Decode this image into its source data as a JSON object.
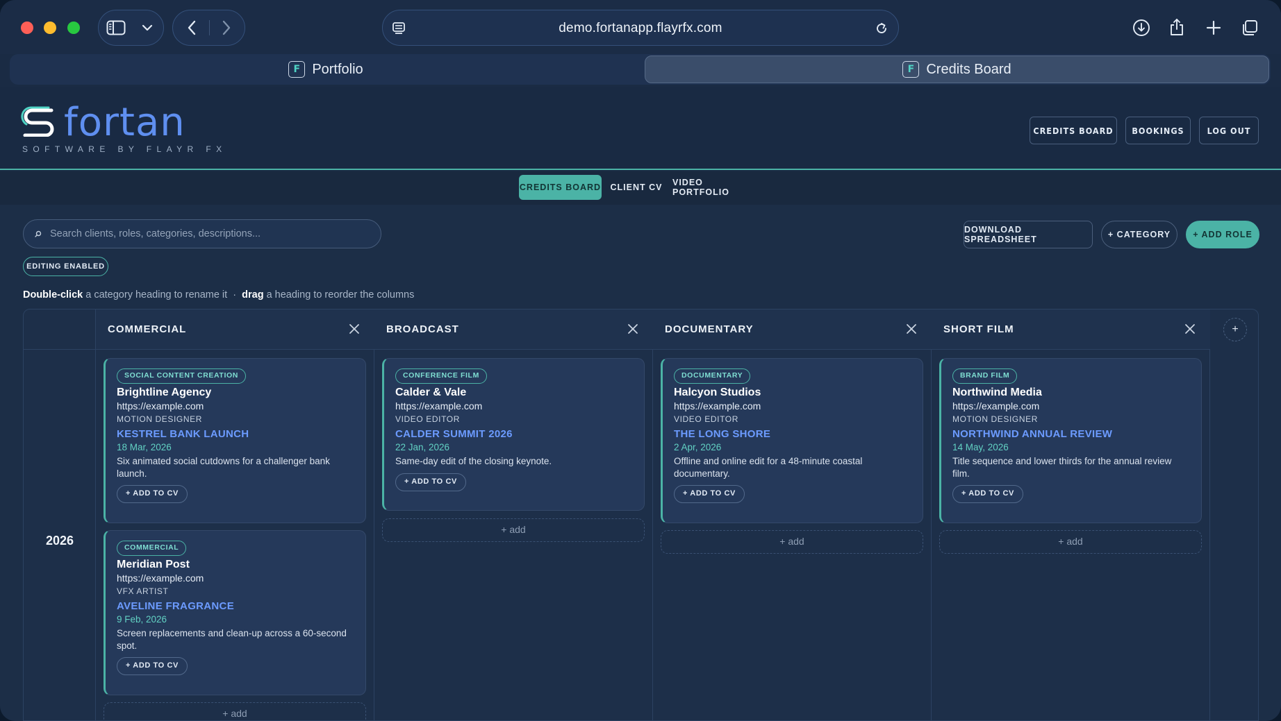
{
  "browser": {
    "url": "demo.fortanapp.flayrfx.com",
    "tabs": [
      {
        "label": "Portfolio",
        "favicon": "F"
      },
      {
        "label": "Credits Board",
        "favicon": "F"
      }
    ]
  },
  "header": {
    "logo_word": "fortan",
    "logo_tagline": "SOFTWARE BY FLAYR FX",
    "nav": [
      "CREDITS BOARD",
      "BOOKINGS",
      "LOG OUT"
    ]
  },
  "subnav": [
    "CREDITS BOARD",
    "CLIENT CV",
    "VIDEO PORTFOLIO"
  ],
  "toolbar": {
    "search_placeholder": "Search clients, roles, categories, descriptions...",
    "download_label": "DOWNLOAD SPREADSHEET",
    "category_label": "+ CATEGORY",
    "add_role_label": "+ ADD ROLE",
    "editing_badge": "EDITING ENABLED"
  },
  "hint": {
    "part1_bold": "Double-click",
    "part2": " a category heading to rename it  ·  ",
    "part3_bold": "drag",
    "part4": " a heading to reorder the columns"
  },
  "board": {
    "year": "2026",
    "add_column_label": "+",
    "add_slot_label": "+ add",
    "columns": [
      {
        "title": "COMMERCIAL",
        "cards": [
          {
            "tag": "SOCIAL CONTENT CREATION",
            "client": "Brightline Agency",
            "url": "https://example.com",
            "role": "MOTION DESIGNER",
            "project": "KESTREL BANK LAUNCH",
            "date": "18 Mar, 2026",
            "desc": "Six animated social cutdowns for a challenger bank launch.",
            "button": "+ ADD TO CV"
          },
          {
            "tag": "COMMERCIAL",
            "client": "Meridian Post",
            "url": "https://example.com",
            "role": "VFX ARTIST",
            "project": "AVELINE FRAGRANCE",
            "date": "9 Feb, 2026",
            "desc": "Screen replacements and clean-up across a 60-second spot.",
            "button": "+ ADD TO CV"
          }
        ]
      },
      {
        "title": "BROADCAST",
        "cards": [
          {
            "tag": "CONFERENCE FILM",
            "client": "Calder & Vale",
            "url": "https://example.com",
            "role": "VIDEO EDITOR",
            "project": "CALDER SUMMIT 2026",
            "date": "22 Jan, 2026",
            "desc": "Same-day edit of the closing keynote.",
            "button": "+ ADD TO CV"
          }
        ]
      },
      {
        "title": "DOCUMENTARY",
        "cards": [
          {
            "tag": "DOCUMENTARY",
            "client": "Halcyon Studios",
            "url": "https://example.com",
            "role": "VIDEO EDITOR",
            "project": "THE LONG SHORE",
            "date": "2 Apr, 2026",
            "desc": "Offline and online edit for a 48-minute coastal documentary.",
            "button": "+ ADD TO CV"
          }
        ]
      },
      {
        "title": "SHORT FILM",
        "cards": [
          {
            "tag": "BRAND FILM",
            "client": "Northwind Media",
            "url": "https://example.com",
            "role": "MOTION DESIGNER",
            "project": "NORTHWIND ANNUAL REVIEW",
            "date": "14 May, 2026",
            "desc": "Title sequence and lower thirds for the annual review film.",
            "button": "+ ADD TO CV"
          }
        ]
      }
    ]
  },
  "colors": {
    "accent": "#4bb3a6",
    "link": "#6c9bff",
    "background": "#1a2b44"
  }
}
